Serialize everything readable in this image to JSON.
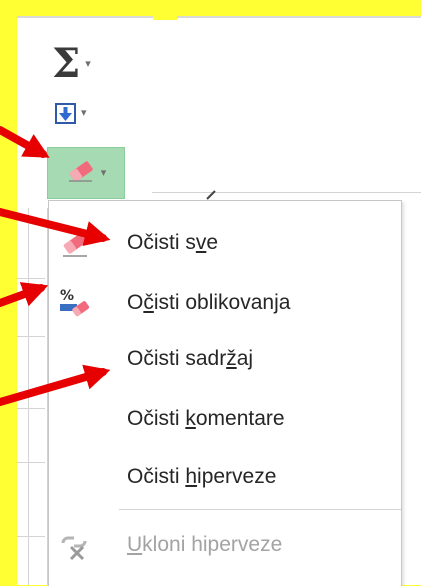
{
  "ribbon": {
    "autosum_icon": "sigma-icon",
    "fill_icon": "fill-down-icon",
    "clear_icon": "eraser-icon",
    "dropdown_icon": "caret-down-icon"
  },
  "menu": {
    "items": [
      {
        "pre": "Očisti s",
        "key": "v",
        "post": "e",
        "icon": "eraser-icon"
      },
      {
        "pre": "O",
        "key": "č",
        "post": "isti oblikovanja",
        "icon": "clear-formats-icon"
      },
      {
        "pre": "Očisti sadr",
        "key": "ž",
        "post": "aj",
        "icon": ""
      },
      {
        "pre": "Očisti ",
        "key": "k",
        "post": "omentare",
        "icon": ""
      },
      {
        "pre": "Očisti ",
        "key": "h",
        "post": "iperveze",
        "icon": ""
      },
      {
        "pre": "",
        "key": "U",
        "post": "kloni hiperveze",
        "icon": "remove-hyperlink-icon",
        "disabled": true
      }
    ]
  },
  "colors": {
    "background": "#ffff33",
    "arrow": "#e60000",
    "selected_button": "#a6dab2",
    "menu_text": "#262626",
    "disabled_text": "#a3a3a3"
  }
}
